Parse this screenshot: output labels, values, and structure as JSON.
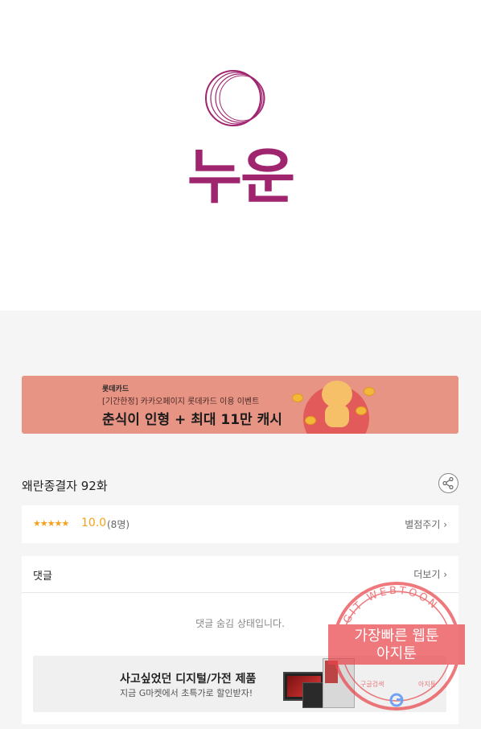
{
  "hero": {
    "logo_text": "누운"
  },
  "banner": {
    "brand": "롯데카드",
    "sub": "[기간한정] 카카오페이지 롯데카드 이용 이벤트",
    "headline": "춘식이 인형 + 최대 11만 캐시"
  },
  "episode": {
    "title": "왜란종결자 92화"
  },
  "rating": {
    "stars": "★★★★★",
    "score": "10.0",
    "count": "(8명)",
    "rate_link": "별점주기 ›"
  },
  "comments": {
    "title": "댓글",
    "more_link": "더보기 ›",
    "hidden_msg": "댓글 숨김 상태입니다."
  },
  "ad": {
    "title": "사고싶었던 디지털/가전 제품",
    "sub": "지금 G마켓에서 초특가로 할인받자!"
  },
  "watermark": {
    "arc_text": "AGIT WEBTOON",
    "line1": "가장빠른 웹툰",
    "line2": "아지툰",
    "bottom_left": "구글검색",
    "bottom_right": "아지툰"
  },
  "colors": {
    "logo": "#a0256f",
    "banner_bg": "#e79485",
    "star": "#f4a21b",
    "watermark": "#e8454a"
  },
  "icons": [
    "share-icon",
    "chevron-right-icon",
    "google-icon"
  ]
}
